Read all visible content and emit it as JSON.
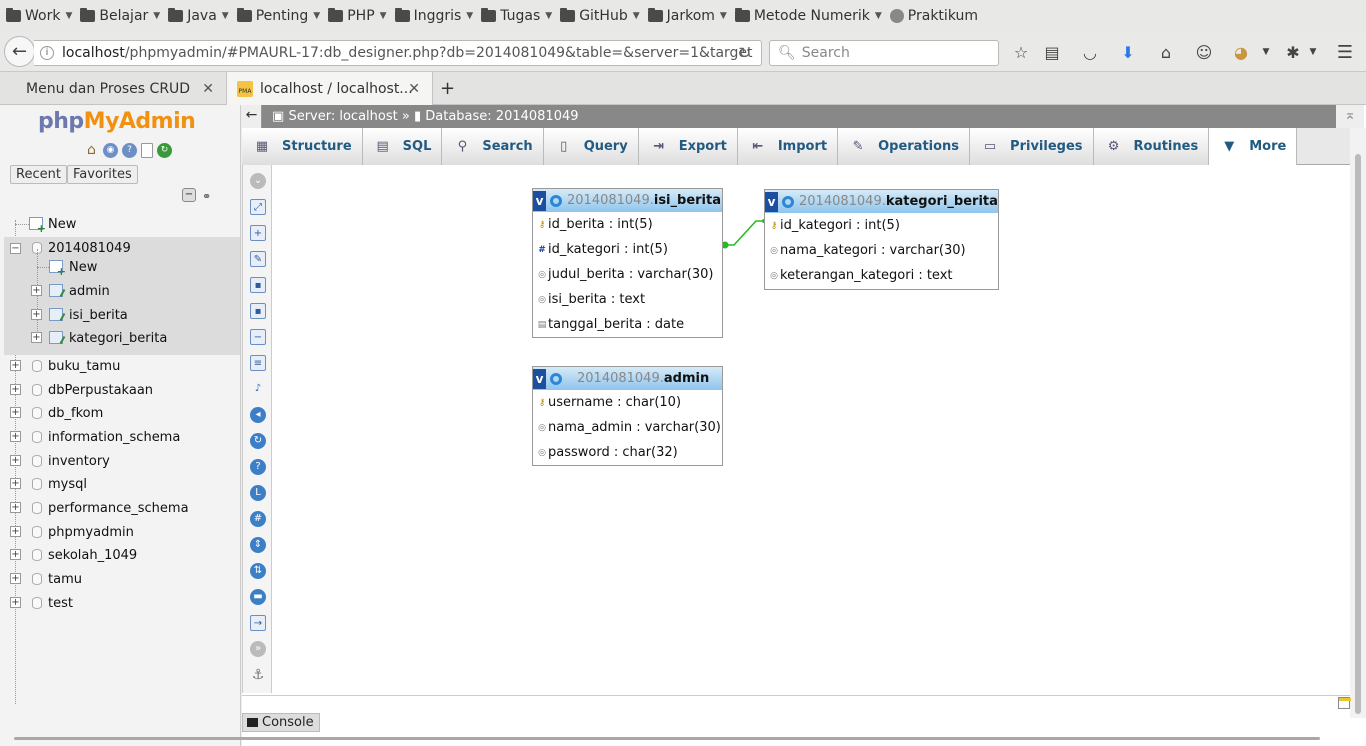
{
  "bookmarks": [
    {
      "label": "Work",
      "type": "folder"
    },
    {
      "label": "Belajar",
      "type": "folder"
    },
    {
      "label": "Java",
      "type": "folder"
    },
    {
      "label": "Penting",
      "type": "folder"
    },
    {
      "label": "PHP",
      "type": "folder"
    },
    {
      "label": "Inggris",
      "type": "folder"
    },
    {
      "label": "Tugas",
      "type": "folder"
    },
    {
      "label": "GitHub",
      "type": "folder"
    },
    {
      "label": "Jarkom",
      "type": "folder"
    },
    {
      "label": "Metode Numerik",
      "type": "folder"
    },
    {
      "label": "Praktikum",
      "type": "link"
    }
  ],
  "browser": {
    "url_host": "localhost",
    "url_path": "/phpmyadmin/#PMAURL-17:db_designer.php?db=2014081049&table=&server=1&target",
    "search_placeholder": "Search"
  },
  "tabs": [
    {
      "label": "Menu dan Proses CRUD",
      "active": false
    },
    {
      "label": "localhost / localhost...",
      "active": true
    }
  ],
  "sidebar": {
    "logo_php": "php",
    "logo_my": "My",
    "logo_admin": "Admin",
    "recent": "Recent",
    "favorites": "Favorites",
    "tree": [
      {
        "label": "New"
      },
      {
        "label": "2014081049"
      },
      {
        "label": "New"
      },
      {
        "label": "admin"
      },
      {
        "label": "isi_berita"
      },
      {
        "label": "kategori_berita"
      },
      {
        "label": "buku_tamu"
      },
      {
        "label": "dbPerpustakaan"
      },
      {
        "label": "db_fkom"
      },
      {
        "label": "information_schema"
      },
      {
        "label": "inventory"
      },
      {
        "label": "mysql"
      },
      {
        "label": "performance_schema"
      },
      {
        "label": "phpmyadmin"
      },
      {
        "label": "sekolah_1049"
      },
      {
        "label": "tamu"
      },
      {
        "label": "test"
      }
    ]
  },
  "breadcrumb": {
    "server": "Server: localhost",
    "sep": "»",
    "database": "Database: 2014081049"
  },
  "menu": [
    {
      "label": "Structure",
      "icon": "structure-icon"
    },
    {
      "label": "SQL",
      "icon": "sql-icon"
    },
    {
      "label": "Search",
      "icon": "search-icon"
    },
    {
      "label": "Query",
      "icon": "query-icon"
    },
    {
      "label": "Export",
      "icon": "export-icon"
    },
    {
      "label": "Import",
      "icon": "import-icon"
    },
    {
      "label": "Operations",
      "icon": "wrench-icon"
    },
    {
      "label": "Privileges",
      "icon": "privileges-icon"
    },
    {
      "label": "Routines",
      "icon": "routines-icon"
    },
    {
      "label": "More",
      "icon": "chevron-down-icon"
    }
  ],
  "designer": {
    "tables": [
      {
        "db": "2014081049",
        "name": "isi_berita",
        "columns": [
          {
            "text": "id_berita : int(5)",
            "key": "primary"
          },
          {
            "text": "id_kategori : int(5)",
            "key": "index"
          },
          {
            "text": "judul_berita : varchar(30)",
            "key": "none"
          },
          {
            "text": "isi_berita : text",
            "key": "none"
          },
          {
            "text": "tanggal_berita : date",
            "key": "date"
          }
        ]
      },
      {
        "db": "2014081049",
        "name": "kategori_berita",
        "columns": [
          {
            "text": "id_kategori : int(5)",
            "key": "primary"
          },
          {
            "text": "nama_kategori : varchar(30)",
            "key": "none"
          },
          {
            "text": "keterangan_kategori : text",
            "key": "none"
          }
        ]
      },
      {
        "db": "2014081049",
        "name": "admin",
        "columns": [
          {
            "text": "username : char(10)",
            "key": "primary"
          },
          {
            "text": "nama_admin : varchar(30)",
            "key": "none"
          },
          {
            "text": "password : char(32)",
            "key": "none"
          }
        ]
      }
    ],
    "toggle_label": "v"
  },
  "console": {
    "label": "Console"
  }
}
